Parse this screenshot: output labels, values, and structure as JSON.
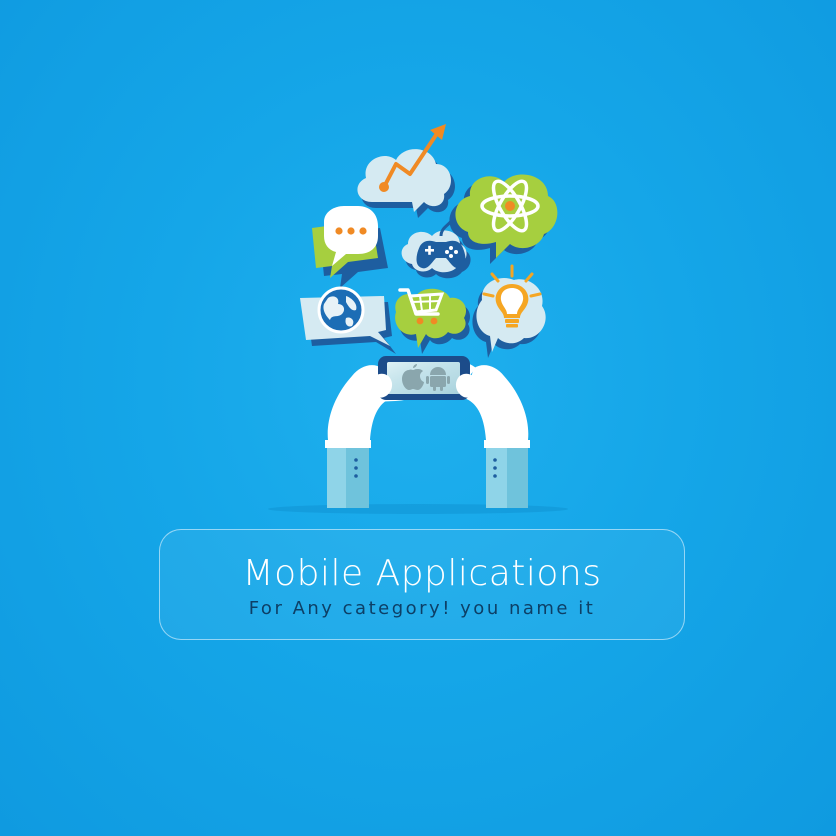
{
  "banner": {
    "title": "Mobile Applications",
    "tagline": "For Any category! you name it"
  },
  "illustration": {
    "icons": [
      "trend-chart-icon",
      "atom-icon",
      "chat-dots-icon",
      "gamepad-icon",
      "globe-icon",
      "shopping-cart-icon",
      "lightbulb-icon",
      "apple-icon",
      "android-icon"
    ]
  },
  "colors": {
    "background": "#15a6e8",
    "bubble_green": "#a6cf3f",
    "bubble_light": "#d7ecf3",
    "accent_orange": "#f08a24",
    "navy": "#1c4c8a",
    "hand_white": "#ffffff",
    "sleeve": "#8fd4e8"
  }
}
